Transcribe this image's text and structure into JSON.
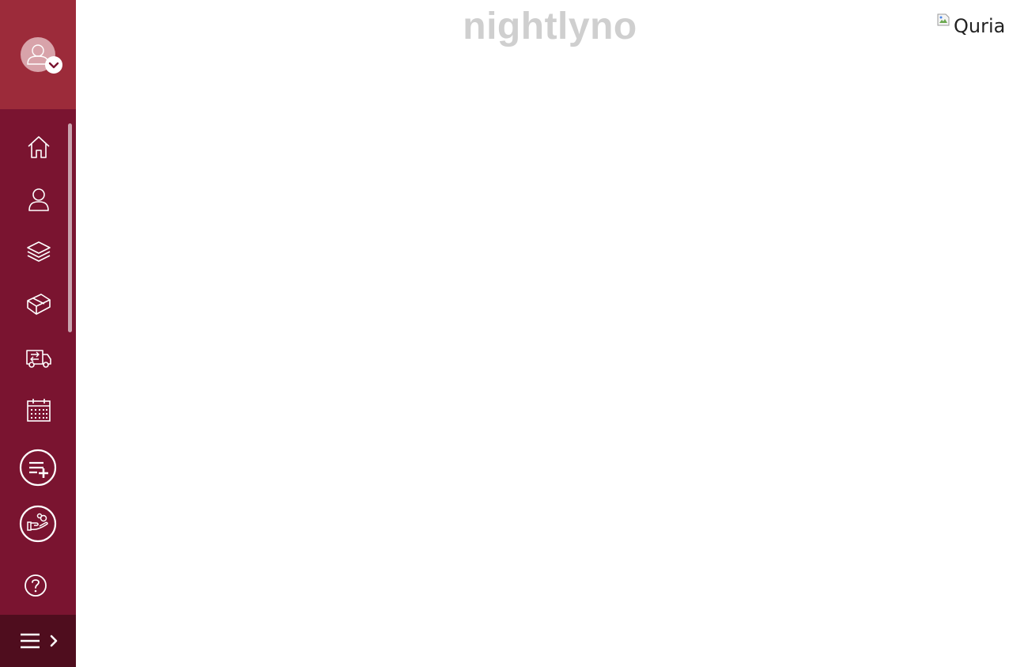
{
  "brand": {
    "title": "nightlyno"
  },
  "logo": {
    "alt": "Quria"
  },
  "sidebar": {
    "avatar": {
      "icon": "user-avatar-icon",
      "badge_icon": "chevron-down-icon"
    },
    "nav": [
      {
        "icon": "home-icon"
      },
      {
        "icon": "user-icon"
      },
      {
        "icon": "layers-icon"
      },
      {
        "icon": "box-icon"
      },
      {
        "icon": "delivery-van-icon"
      },
      {
        "icon": "calendar-icon"
      }
    ],
    "actions": [
      {
        "icon": "add-list-icon"
      },
      {
        "icon": "giving-hand-icon"
      }
    ],
    "help": {
      "icon": "help-icon"
    },
    "toggle": {
      "icon": "menu-expand-icon"
    }
  },
  "colors": {
    "sidebar": "#7a1430",
    "sidebar_top": "#9c2b3a",
    "sidebar_bottom": "#4f0d1e",
    "title": "#cfcfcf"
  }
}
